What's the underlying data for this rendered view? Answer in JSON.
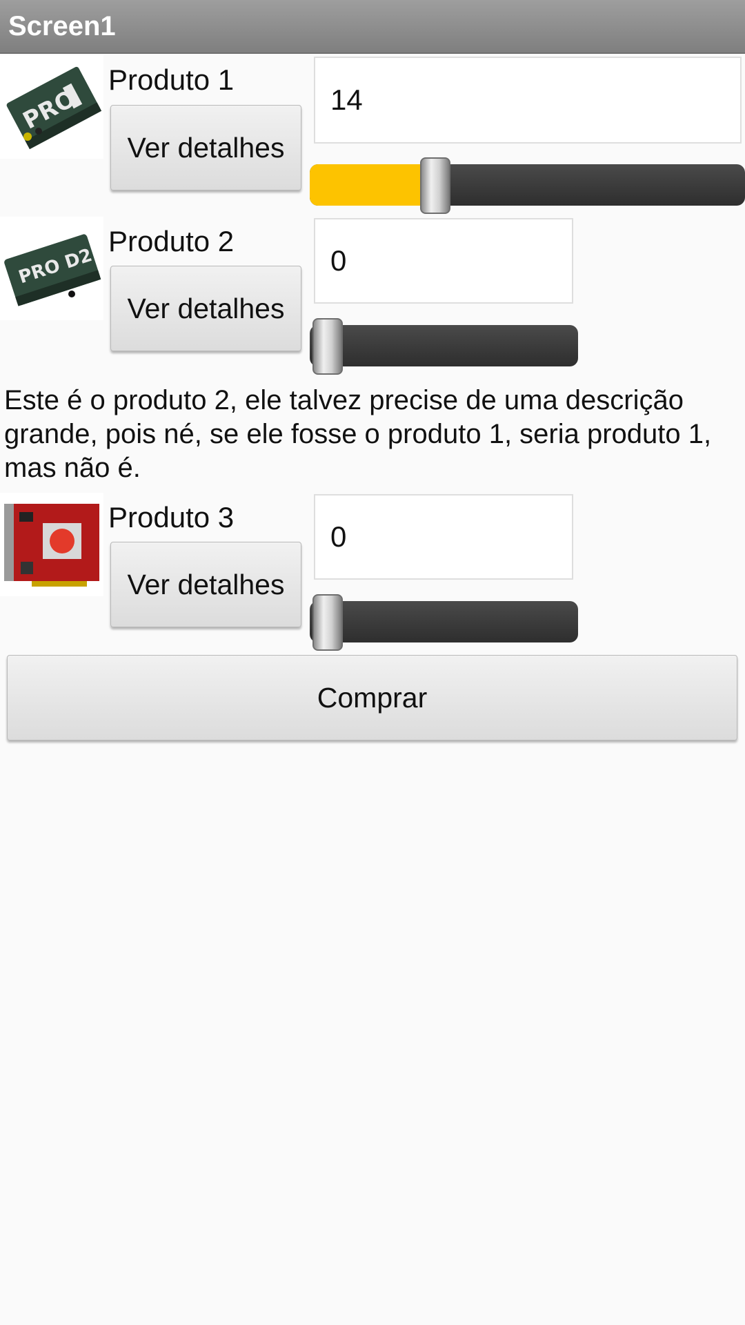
{
  "app": {
    "title": "Screen1"
  },
  "colors": {
    "accent": "#fdc300",
    "titlebar": "#8a8a8a",
    "background": "#fafafa"
  },
  "products": [
    {
      "label": "Produto 1",
      "button": "Ver detalhes",
      "quantity": "14",
      "slider_fraction": 0.29,
      "image": "stereo-di-box-pro1"
    },
    {
      "label": "Produto 2",
      "button": "Ver detalhes",
      "quantity": "0",
      "slider_fraction": 0.0,
      "image": "stereo-di-box-pro-d2"
    },
    {
      "label": "Produto 3",
      "button": "Ver detalhes",
      "quantity": "0",
      "slider_fraction": 0.0,
      "image": "graphics-card"
    }
  ],
  "description": "Este é o produto 2, ele talvez precise de uma descrição grande, pois né, se ele fosse o produto 1, seria produto 1, mas não é.",
  "buy_button": "Comprar"
}
